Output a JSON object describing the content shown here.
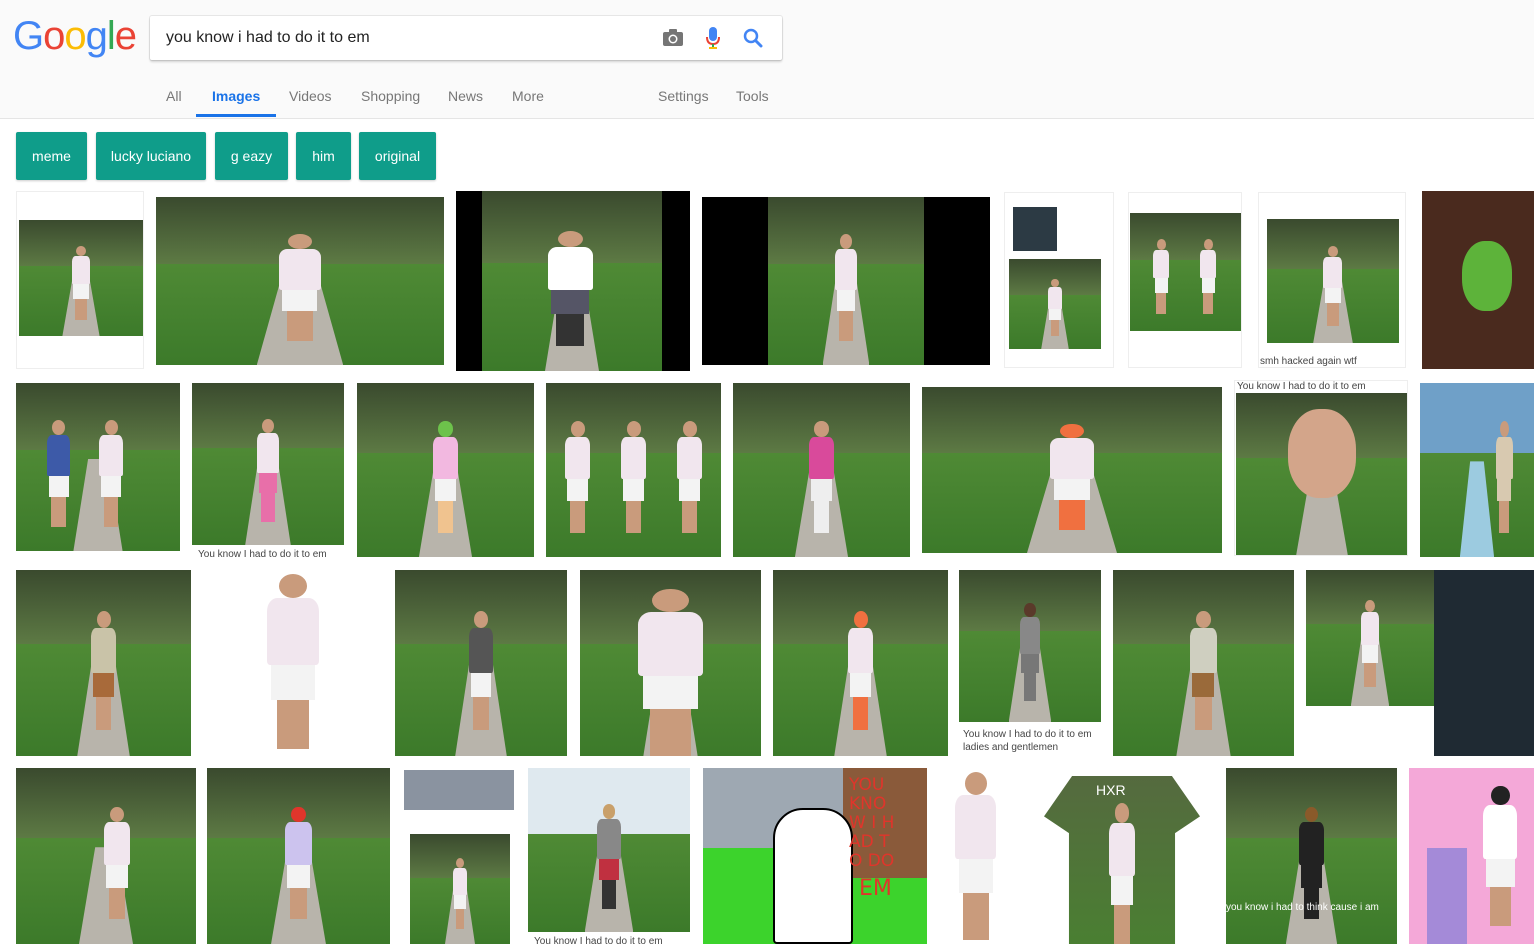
{
  "search": {
    "query": "you know i had to do it to em"
  },
  "logo": {
    "letters": [
      "G",
      "o",
      "o",
      "g",
      "l",
      "e"
    ],
    "colors": [
      "#4285f4",
      "#ea4335",
      "#fbbc05",
      "#4285f4",
      "#34a853",
      "#ea4335"
    ]
  },
  "tabs": {
    "all": "All",
    "images": "Images",
    "videos": "Videos",
    "shopping": "Shopping",
    "news": "News",
    "more": "More",
    "settings": "Settings",
    "tools": "Tools"
  },
  "chips": [
    "meme",
    "lucky luciano",
    "g eazy",
    "him",
    "original"
  ],
  "captions": {
    "c1": "smh hacked again wtf",
    "c2": "You know I had to do it to em",
    "c3": "You know I had to do it to em",
    "c4": "You know I had to do it to em",
    "c5": "ladies and gentlemen",
    "c6": "you know i had to think cause i am",
    "c7": "you know I had to do it to em",
    "c8": "You know I had to do it to em"
  },
  "art_text": {
    "left": "YOU KNOW I HAD TO DO",
    "right": "EM",
    "shirt": "HXR"
  },
  "colors": {
    "accent": "#1a73e8",
    "chip": "#0f9d8a"
  }
}
